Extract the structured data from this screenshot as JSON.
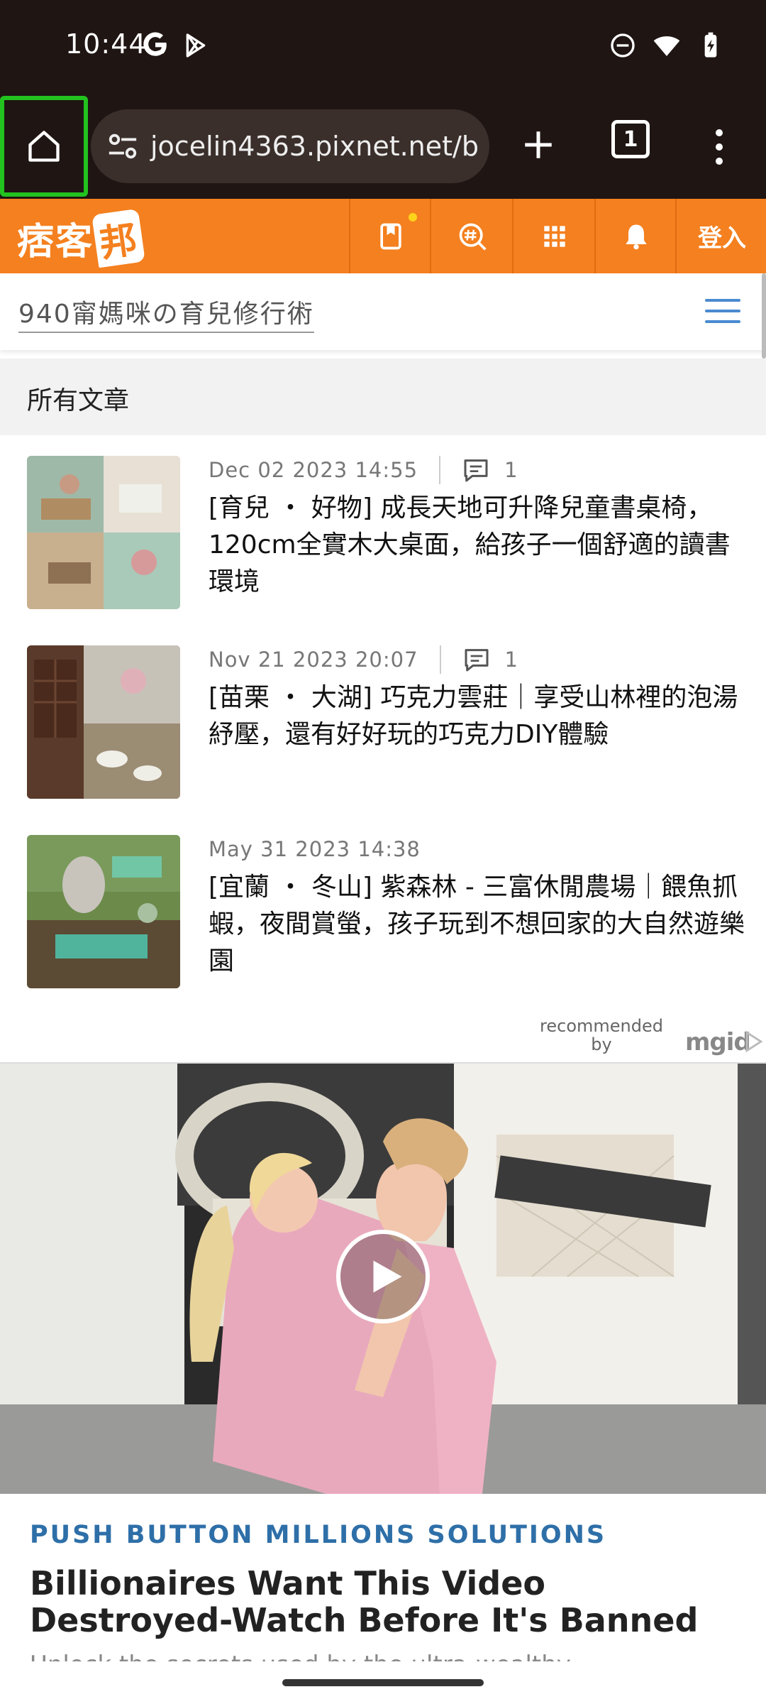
{
  "status_bar": {
    "time": "10:44",
    "icons": [
      "google-g-icon",
      "play-store-icon",
      "do-not-disturb-icon",
      "wifi-icon",
      "battery-charging-icon"
    ]
  },
  "browser": {
    "url": "jocelin4363.pixnet.net/b",
    "tab_count": "1",
    "highlight_color": "#22c21f"
  },
  "pixnet": {
    "logo": "痞客",
    "logo_mark": "邦",
    "login": "登入",
    "brand_color": "#f4801f",
    "tools": [
      "bookmark-icon",
      "hashtag-search-icon",
      "apps-grid-icon",
      "bell-icon"
    ]
  },
  "blog": {
    "title": "940甯媽咪の育兒修行術"
  },
  "section": {
    "title": "所有文章"
  },
  "articles": [
    {
      "date": "Dec 02 2023 14:55",
      "comments": "1",
      "title": "[育兒 ・ 好物] 成長天地可升降兒童書桌椅，120cm全實木大桌面，給孩子一個舒適的讀書環境"
    },
    {
      "date": "Nov 21 2023 20:07",
      "comments": "1",
      "title": "[苗栗 ・ 大湖] 巧克力雲莊｜享受山林裡的泡湯紓壓，還有好好玩的巧克力DIY體驗"
    },
    {
      "date": "May 31 2023 14:38",
      "title": "[宜蘭 ・ 冬山] 紫森林 - 三富休閒農場｜餵魚抓蝦，夜間賞螢，孩子玩到不想回家的大自然遊樂園"
    }
  ],
  "ad": {
    "recommended_by": "recommended by",
    "provider": "mgid",
    "source": "PUSH BUTTON MILLIONS SOLUTIONS",
    "headline": "Billionaires Want This Video Destroyed-Watch Before It's Banned",
    "teaser_cut": "Unlock the secrets used by the ultra-wealthy"
  }
}
